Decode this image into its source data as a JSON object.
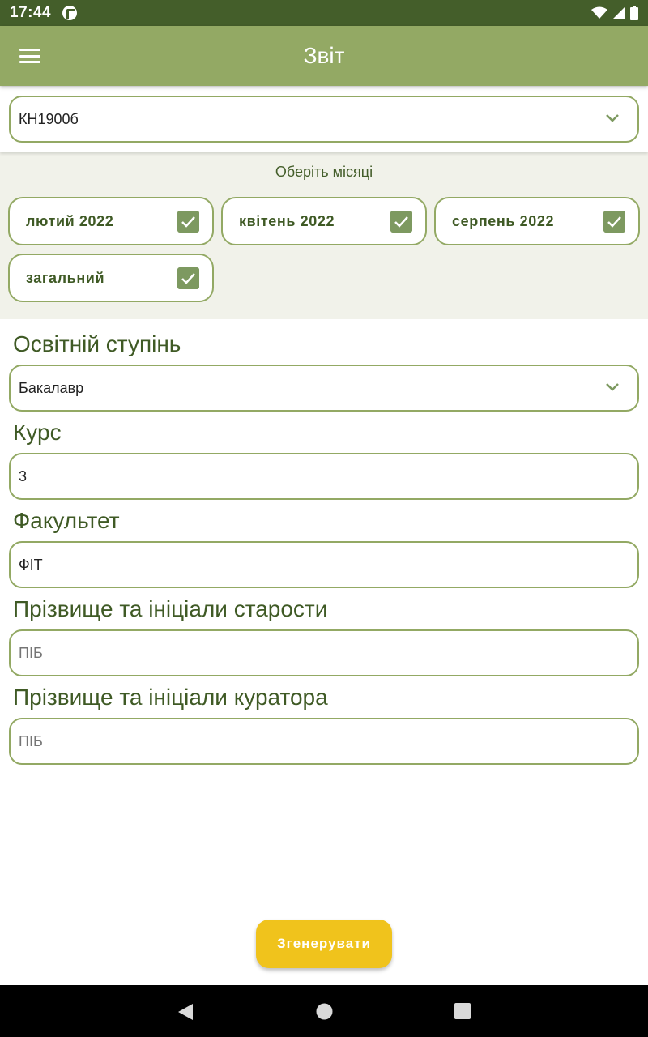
{
  "status_bar": {
    "time": "17:44",
    "app_icon": "app-notification-icon",
    "icons": [
      "wifi-icon",
      "signal-icon",
      "battery-icon"
    ]
  },
  "app_bar": {
    "title": "Звіт",
    "menu_icon": "hamburger-menu-icon"
  },
  "group_select": {
    "value": "КН1900б"
  },
  "months": {
    "label": "Оберіть місяці",
    "items": [
      {
        "label": "лютий 2022",
        "checked": true
      },
      {
        "label": "квітень 2022",
        "checked": true
      },
      {
        "label": "серпень 2022",
        "checked": true
      },
      {
        "label": "загальний",
        "checked": true
      }
    ]
  },
  "form": {
    "degree": {
      "label": "Освітній ступінь",
      "value": "Бакалавр"
    },
    "course": {
      "label": "Курс",
      "value": "3"
    },
    "faculty": {
      "label": "Факультет",
      "value": "ФІТ"
    },
    "headman": {
      "label": "Прізвище та ініціали старости",
      "value": "",
      "placeholder": "ПІБ"
    },
    "curator": {
      "label": "Прізвище та ініціали куратора",
      "value": "",
      "placeholder": "ПІБ"
    }
  },
  "generate_button": {
    "label": "Згенерувати"
  },
  "colors": {
    "status_bar": "#445e2a",
    "app_bar": "#93a964",
    "accent_text": "#3f5a25",
    "border": "#93a964",
    "checkbox": "#7d9960",
    "months_bg": "#f1f2ea",
    "button": "#f0c31c"
  },
  "nav_bar": {
    "icons": [
      "back-icon",
      "home-icon",
      "recents-icon"
    ]
  }
}
